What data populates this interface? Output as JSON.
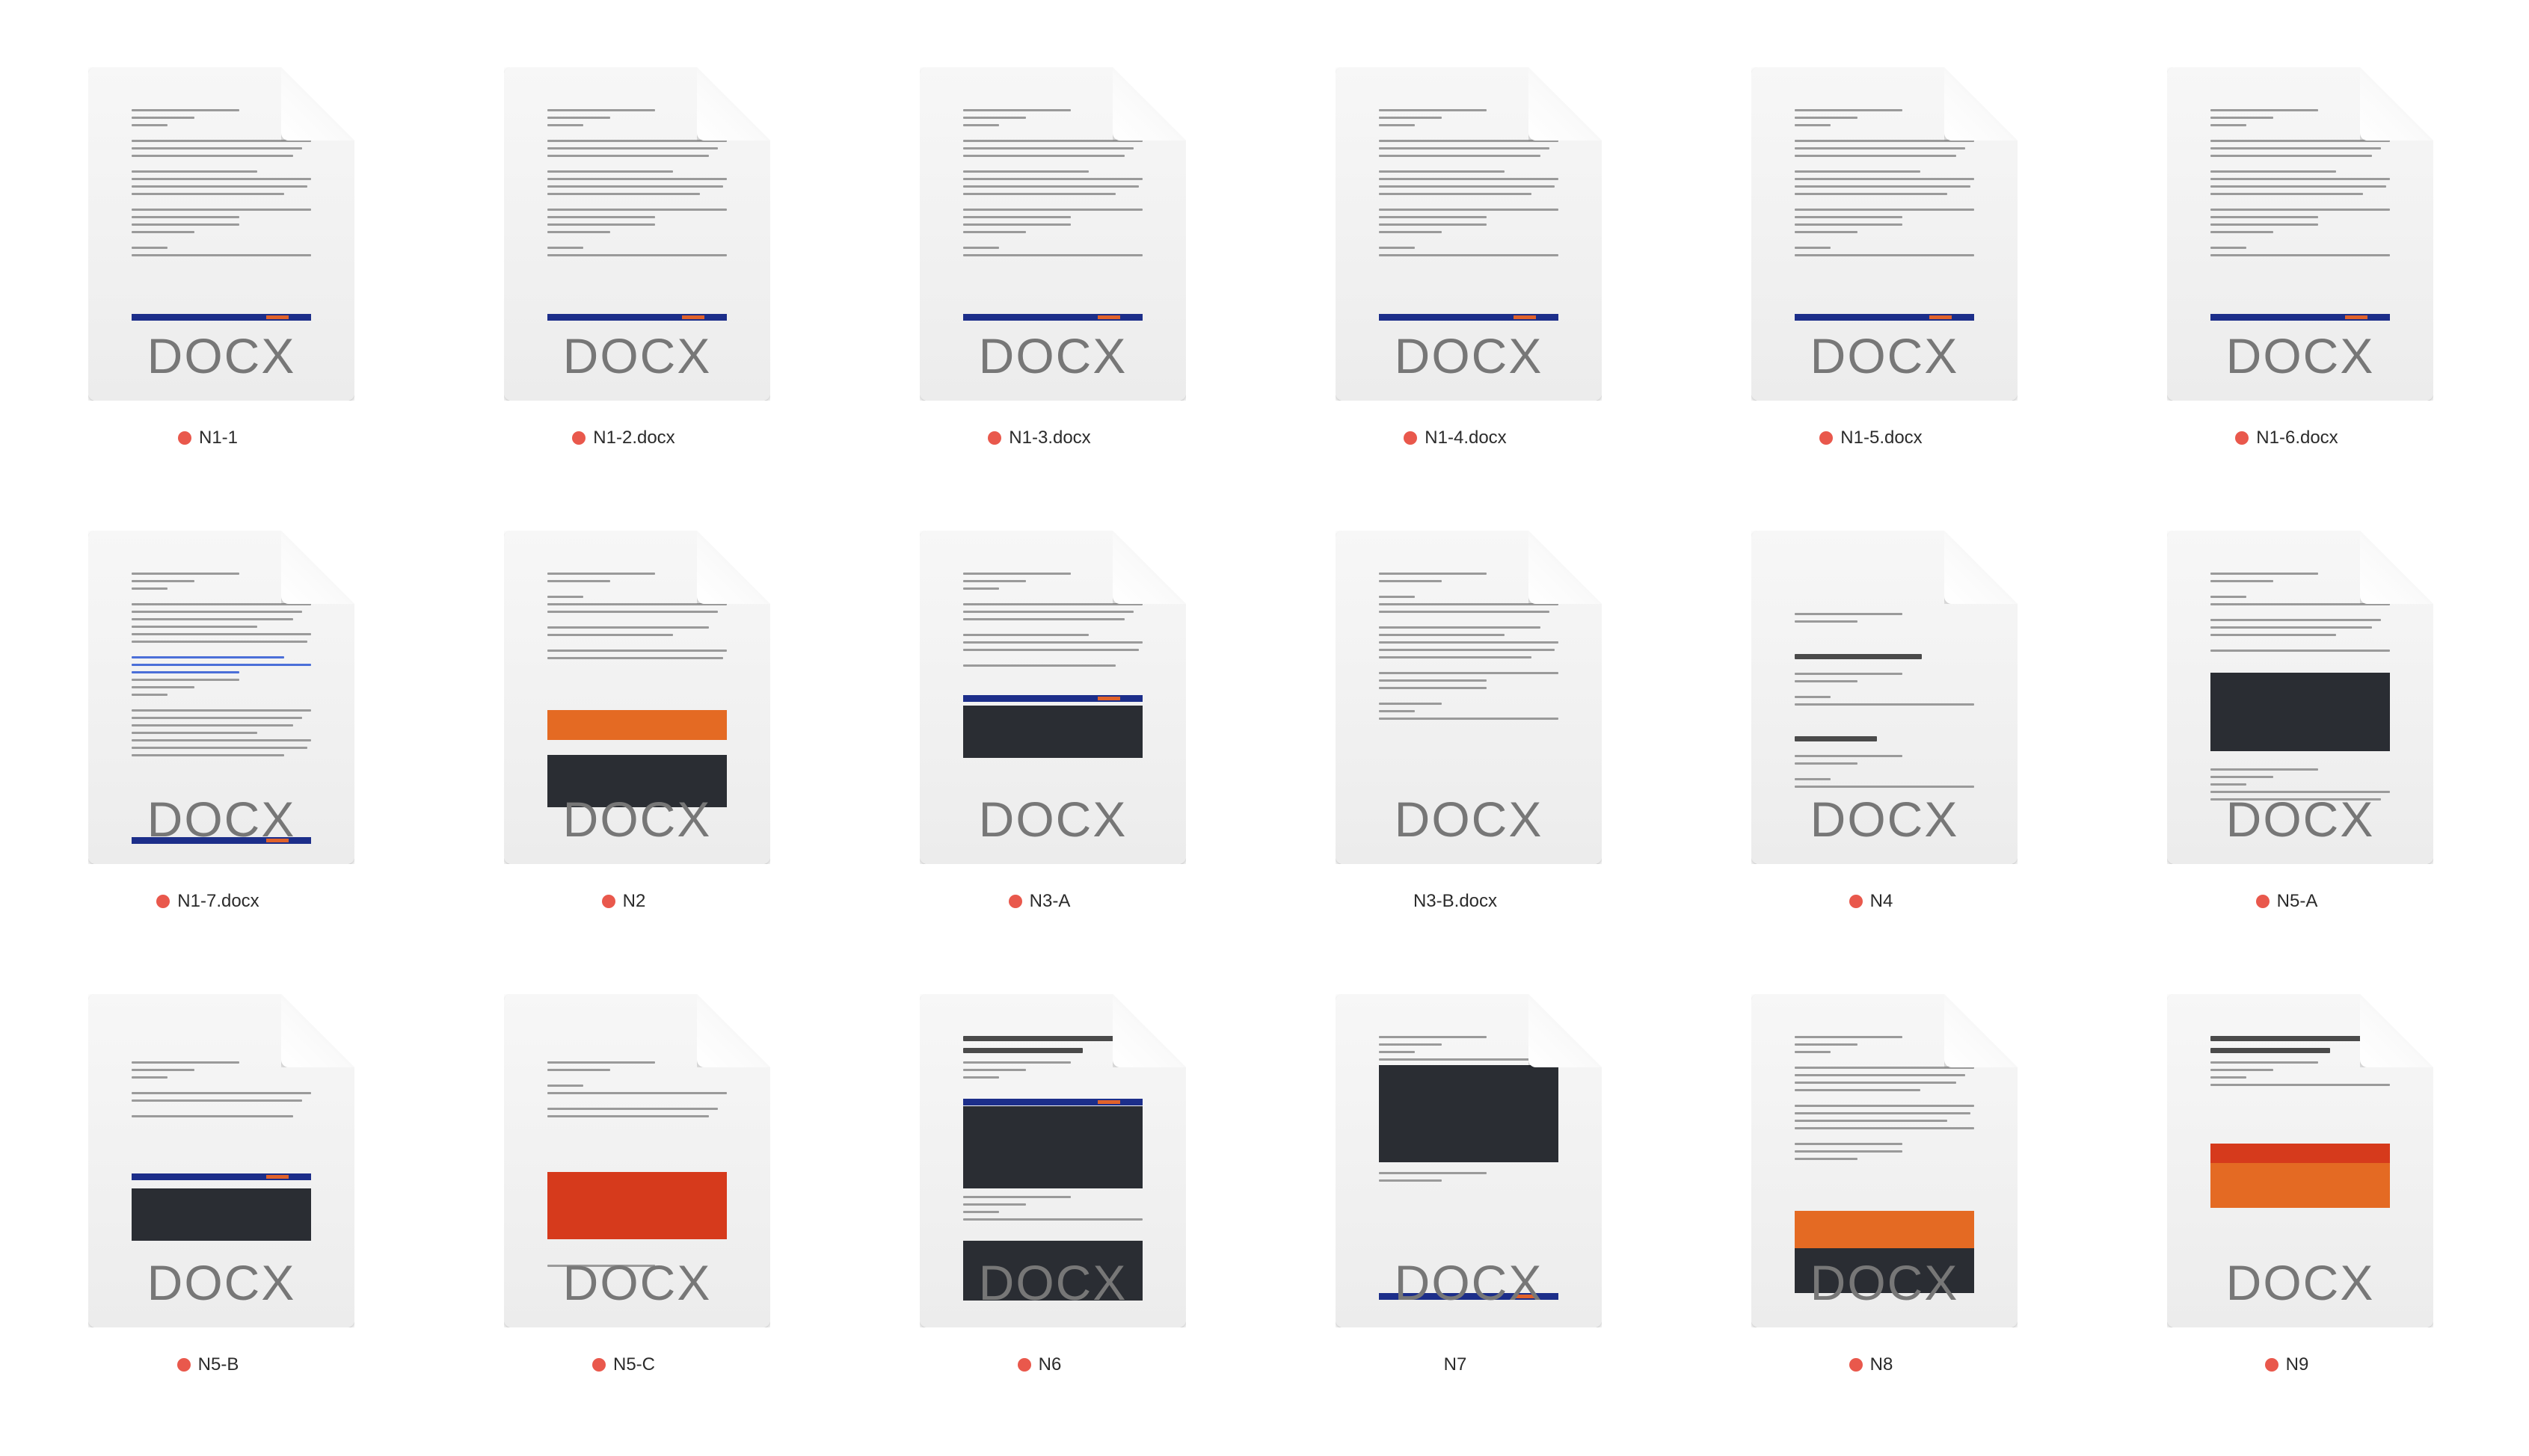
{
  "colors": {
    "tag": "#e9584c",
    "docx_text": "#777777",
    "banner": "#1c2e8a",
    "accent_orange": "#e46a23"
  },
  "file_type_label": "DOCX",
  "files": [
    {
      "name": "N1-1",
      "tag": "red",
      "preview": "text-banner"
    },
    {
      "name": "N1-2.docx",
      "tag": "red",
      "preview": "text-banner"
    },
    {
      "name": "N1-3.docx",
      "tag": "red",
      "preview": "text-banner"
    },
    {
      "name": "N1-4.docx",
      "tag": "red",
      "preview": "text-banner"
    },
    {
      "name": "N1-5.docx",
      "tag": "red",
      "preview": "text-banner"
    },
    {
      "name": "N1-6.docx",
      "tag": "red",
      "preview": "text-banner"
    },
    {
      "name": "N1-7.docx",
      "tag": "red",
      "preview": "text-links"
    },
    {
      "name": "N2",
      "tag": "red",
      "preview": "form-orange"
    },
    {
      "name": "N3-A",
      "tag": "red",
      "preview": "text-banner-short"
    },
    {
      "name": "N3-B.docx",
      "tag": "none",
      "preview": "text-only"
    },
    {
      "name": "N4",
      "tag": "red",
      "preview": "announcement"
    },
    {
      "name": "N5-A",
      "tag": "red",
      "preview": "dark-screenshot"
    },
    {
      "name": "N5-B",
      "tag": "red",
      "preview": "dark-screenshot-low"
    },
    {
      "name": "N5-C",
      "tag": "red",
      "preview": "blog-screenshot"
    },
    {
      "name": "N6",
      "tag": "red",
      "preview": "action-required"
    },
    {
      "name": "N7",
      "tag": "none",
      "preview": "dark-box"
    },
    {
      "name": "N8",
      "tag": "red",
      "preview": "orange-logo"
    },
    {
      "name": "N9",
      "tag": "red",
      "preview": "red-banner"
    }
  ]
}
